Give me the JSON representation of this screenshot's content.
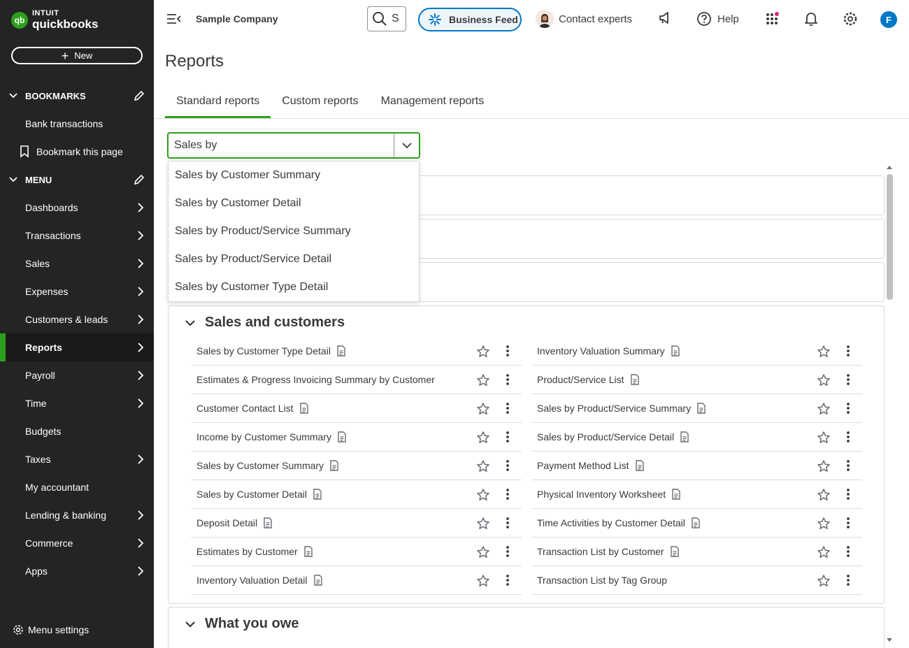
{
  "brand": {
    "line1": "INTUIT",
    "line2": "quickbooks",
    "mark": "qb"
  },
  "sidebar": {
    "new_label": "New",
    "bookmarks_label": "BOOKMARKS",
    "bookmarks": [
      {
        "label": "Bank transactions"
      },
      {
        "label": "Bookmark this page"
      }
    ],
    "menu_label": "MENU",
    "items": [
      {
        "label": "Dashboards",
        "arrow": true
      },
      {
        "label": "Transactions",
        "arrow": true
      },
      {
        "label": "Sales",
        "arrow": true
      },
      {
        "label": "Expenses",
        "arrow": true
      },
      {
        "label": "Customers & leads",
        "arrow": true
      },
      {
        "label": "Reports",
        "arrow": true,
        "active": true
      },
      {
        "label": "Payroll",
        "arrow": true
      },
      {
        "label": "Time",
        "arrow": true
      },
      {
        "label": "Budgets",
        "arrow": false
      },
      {
        "label": "Taxes",
        "arrow": true
      },
      {
        "label": "My accountant",
        "arrow": false
      },
      {
        "label": "Lending & banking",
        "arrow": true
      },
      {
        "label": "Commerce",
        "arrow": true
      },
      {
        "label": "Apps",
        "arrow": true
      }
    ],
    "menu_settings_label": "Menu settings"
  },
  "header": {
    "company": "Sample Company",
    "search_value": "S",
    "business_feed": "Business Feed",
    "contact_experts": "Contact experts",
    "help": "Help",
    "user_initial": "F"
  },
  "page": {
    "title": "Reports",
    "tabs": [
      {
        "label": "Standard reports",
        "active": true
      },
      {
        "label": "Custom reports",
        "active": false
      },
      {
        "label": "Management reports",
        "active": false
      }
    ]
  },
  "report_search": {
    "value": "Sales by",
    "options": [
      "Sales by Customer Summary",
      "Sales by Customer Detail",
      "Sales by Product/Service Summary",
      "Sales by Product/Service Detail",
      "Sales by Customer Type Detail"
    ]
  },
  "sections": {
    "sales_customers": {
      "title": "Sales and customers",
      "left": [
        {
          "name": "Sales by Customer Type Detail",
          "doc": true
        },
        {
          "name": "Estimates & Progress Invoicing Summary by Customer",
          "doc": false
        },
        {
          "name": "Customer Contact List",
          "doc": true
        },
        {
          "name": "Income by Customer Summary",
          "doc": true
        },
        {
          "name": "Sales by Customer Summary",
          "doc": true
        },
        {
          "name": "Sales by Customer Detail",
          "doc": true
        },
        {
          "name": "Deposit Detail",
          "doc": true
        },
        {
          "name": "Estimates by Customer",
          "doc": true
        },
        {
          "name": "Inventory Valuation Detail",
          "doc": true
        }
      ],
      "right": [
        {
          "name": "Inventory Valuation Summary",
          "doc": true
        },
        {
          "name": "Product/Service List",
          "doc": true
        },
        {
          "name": "Sales by Product/Service Summary",
          "doc": true
        },
        {
          "name": "Sales by Product/Service Detail",
          "doc": true
        },
        {
          "name": "Payment Method List",
          "doc": true
        },
        {
          "name": "Physical Inventory Worksheet",
          "doc": true
        },
        {
          "name": "Time Activities by Customer Detail",
          "doc": true
        },
        {
          "name": "Transaction List by Customer",
          "doc": true
        },
        {
          "name": "Transaction List by Tag Group",
          "doc": false
        }
      ]
    },
    "what_you_owe": {
      "title": "What you owe"
    }
  },
  "colors": {
    "accent_green": "#2ca01c",
    "sidebar_bg": "#242424",
    "brand_blue": "#0077c5"
  }
}
